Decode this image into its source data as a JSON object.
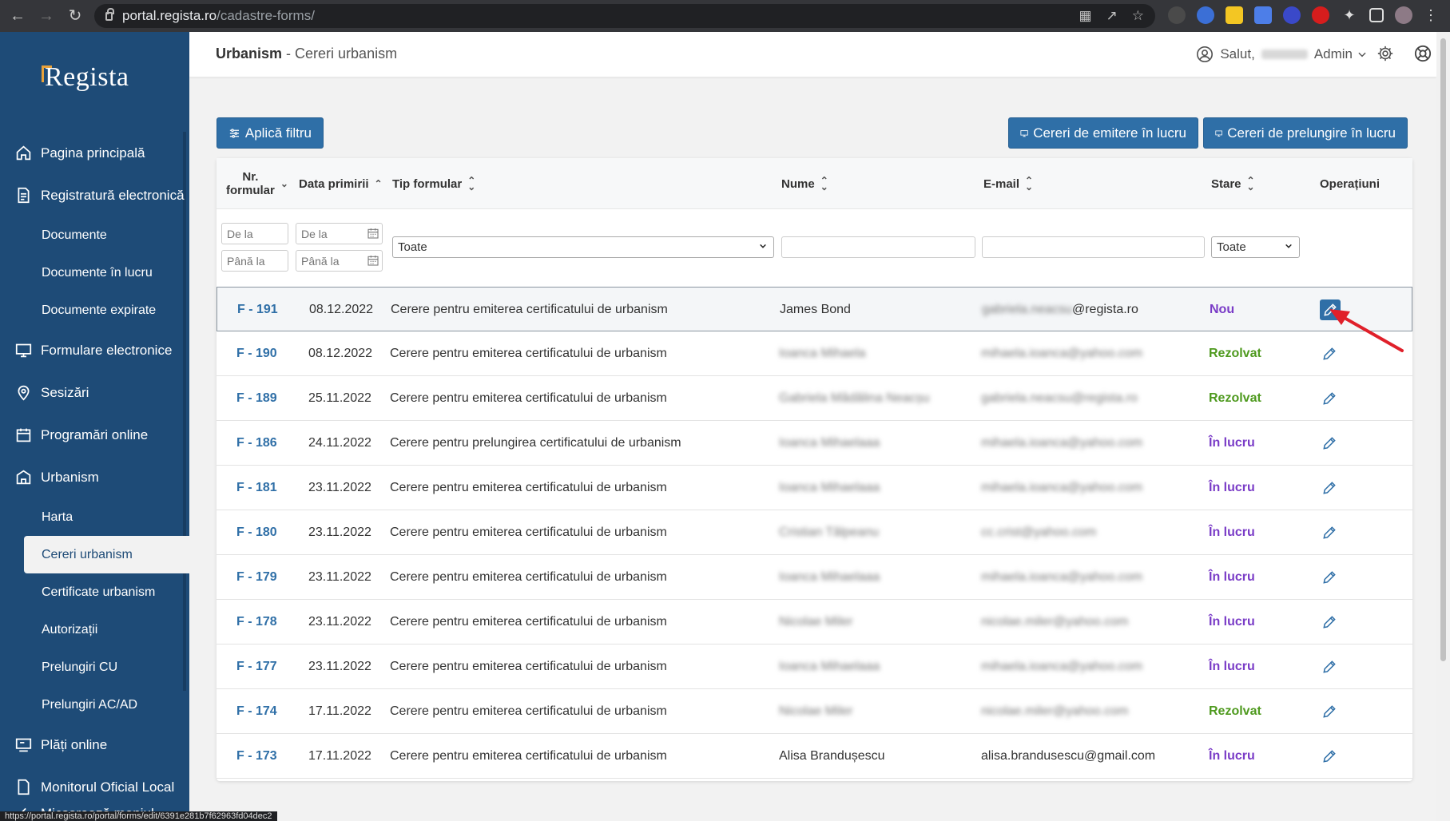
{
  "browser": {
    "url_host": "portal.regista.ro",
    "url_path": "/cadastre-forms/",
    "status_url": "https://portal.regista.ro/portal/forms/edit/6391e281b7f62963fd04dec2"
  },
  "sidebar": {
    "logo": "Regista",
    "items": [
      {
        "label": "Pagina principală",
        "icon": "home-icon",
        "type": "main"
      },
      {
        "label": "Registratură electronică",
        "icon": "document-icon",
        "type": "main"
      },
      {
        "label": "Documente",
        "type": "sub"
      },
      {
        "label": "Documente în lucru",
        "type": "sub"
      },
      {
        "label": "Documente expirate",
        "type": "sub"
      },
      {
        "label": "Formulare electronice",
        "icon": "monitor-icon",
        "type": "main"
      },
      {
        "label": "Sesizări",
        "icon": "map-pin-icon",
        "type": "main"
      },
      {
        "label": "Programări online",
        "icon": "calendar-icon",
        "type": "main"
      },
      {
        "label": "Urbanism",
        "icon": "building-icon",
        "type": "main"
      },
      {
        "label": "Harta",
        "type": "sub"
      },
      {
        "label": "Cereri urbanism",
        "type": "sub",
        "active": true
      },
      {
        "label": "Certificate urbanism",
        "type": "sub"
      },
      {
        "label": "Autorizații",
        "type": "sub"
      },
      {
        "label": "Prelungiri CU",
        "type": "sub"
      },
      {
        "label": "Prelungiri AC/AD",
        "type": "sub"
      },
      {
        "label": "Plăți online",
        "icon": "payment-icon",
        "type": "main"
      },
      {
        "label": "Monitorul Oficial Local",
        "icon": "document-icon",
        "type": "main"
      },
      {
        "label": "Micșorează meniul",
        "icon": "chevron-left-icon",
        "type": "main"
      }
    ]
  },
  "header": {
    "section": "Urbanism",
    "separator": " - ",
    "page": "Cereri urbanism",
    "greeting": "Salut,",
    "role": "Admin"
  },
  "toolbar": {
    "filter_label": "Aplică filtru",
    "emit_label": "Cereri de emitere în lucru",
    "prolong_label": "Cereri de prelungire în lucru"
  },
  "table": {
    "columns": {
      "nr_line1": "Nr.",
      "nr_line2": "formular",
      "date": "Data primirii",
      "tip": "Tip formular",
      "name": "Nume",
      "email": "E-mail",
      "stare": "Stare",
      "op": "Operațiuni"
    },
    "filters": {
      "from_placeholder": "De la",
      "to_placeholder": "Până la",
      "tip_selected": "Toate",
      "stare_selected": "Toate"
    },
    "rows": [
      {
        "nr": "F - 191",
        "date": "08.12.2022",
        "tip": "Cerere pentru emiterea certificatului de urbanism",
        "name": "James Bond",
        "name_blur": false,
        "email_prefix": "gabriela.neacsu",
        "email": "@regista.ro",
        "stare": "Nou",
        "stare_kind": "nou",
        "selected": true
      },
      {
        "nr": "F - 190",
        "date": "08.12.2022",
        "tip": "Cerere pentru emiterea certificatului de urbanism",
        "name": "Ioanca Mihaela",
        "name_blur": true,
        "email_prefix": "",
        "email": "mihaela.ioanca@yahoo.com",
        "email_blur": true,
        "stare": "Rezolvat",
        "stare_kind": "rez"
      },
      {
        "nr": "F - 189",
        "date": "25.11.2022",
        "tip": "Cerere pentru emiterea certificatului de urbanism",
        "name": "Gabriela Mădălina Neacșu",
        "name_blur": true,
        "email_prefix": "",
        "email": "gabriela.neacsu@regista.ro",
        "email_blur": true,
        "stare": "Rezolvat",
        "stare_kind": "rez"
      },
      {
        "nr": "F - 186",
        "date": "24.11.2022",
        "tip": "Cerere pentru prelungirea certificatului de urbanism",
        "name": "Ioanca Mihaelaaa",
        "name_blur": true,
        "email_prefix": "",
        "email": "mihaela.ioanca@yahoo.com",
        "email_blur": true,
        "stare": "În lucru",
        "stare_kind": "lucru"
      },
      {
        "nr": "F - 181",
        "date": "23.11.2022",
        "tip": "Cerere pentru emiterea certificatului de urbanism",
        "name": "Ioanca Mihaelaaa",
        "name_blur": true,
        "email_prefix": "",
        "email": "mihaela.ioanca@yahoo.com",
        "email_blur": true,
        "stare": "În lucru",
        "stare_kind": "lucru"
      },
      {
        "nr": "F - 180",
        "date": "23.11.2022",
        "tip": "Cerere pentru emiterea certificatului de urbanism",
        "name": "Cristian Tălpeanu",
        "name_blur": true,
        "email_prefix": "",
        "email": "cc.crist@yahoo.com",
        "email_blur": true,
        "stare": "În lucru",
        "stare_kind": "lucru"
      },
      {
        "nr": "F - 179",
        "date": "23.11.2022",
        "tip": "Cerere pentru emiterea certificatului de urbanism",
        "name": "Ioanca Mihaelaaa",
        "name_blur": true,
        "email_prefix": "",
        "email": "mihaela.ioanca@yahoo.com",
        "email_blur": true,
        "stare": "În lucru",
        "stare_kind": "lucru"
      },
      {
        "nr": "F - 178",
        "date": "23.11.2022",
        "tip": "Cerere pentru emiterea certificatului de urbanism",
        "name": "Nicolae Miler",
        "name_blur": true,
        "email_prefix": "",
        "email": "nicolae.miler@yahoo.com",
        "email_blur": true,
        "stare": "În lucru",
        "stare_kind": "lucru"
      },
      {
        "nr": "F - 177",
        "date": "23.11.2022",
        "tip": "Cerere pentru emiterea certificatului de urbanism",
        "name": "Ioanca Mihaelaaa",
        "name_blur": true,
        "email_prefix": "",
        "email": "mihaela.ioanca@yahoo.com",
        "email_blur": true,
        "stare": "În lucru",
        "stare_kind": "lucru"
      },
      {
        "nr": "F - 174",
        "date": "17.11.2022",
        "tip": "Cerere pentru emiterea certificatului de urbanism",
        "name": "Nicolae Miler",
        "name_blur": true,
        "email_prefix": "",
        "email": "nicolae.miler@yahoo.com",
        "email_blur": true,
        "stare": "Rezolvat",
        "stare_kind": "rez"
      },
      {
        "nr": "F - 173",
        "date": "17.11.2022",
        "tip": "Cerere pentru emiterea certificatului de urbanism",
        "name": "Alisa Brandușescu",
        "name_blur": false,
        "email_prefix": "",
        "email": "alisa.brandusescu@gmail.com",
        "email_blur": false,
        "stare": "În lucru",
        "stare_kind": "lucru"
      }
    ]
  },
  "colors": {
    "sidebar_bg": "#1e4b77",
    "primary": "#2f6fa7",
    "status_new": "#7a3cc7",
    "status_resolved": "#4f9a1f",
    "status_in_progress": "#7a3cc7",
    "annotation_arrow": "#e0202a"
  }
}
